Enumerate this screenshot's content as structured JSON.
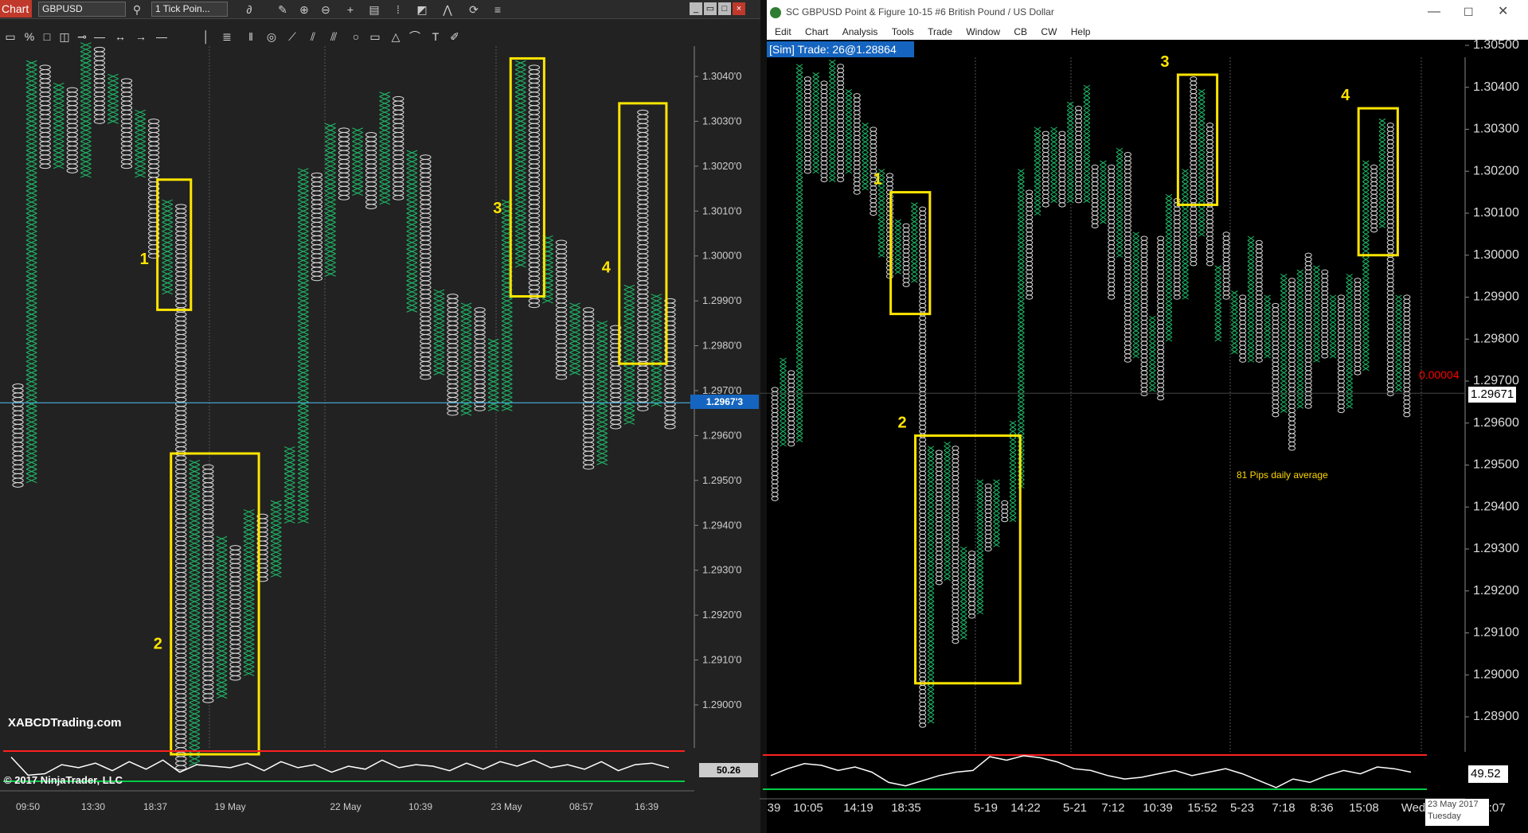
{
  "left_window": {
    "tab": "Chart",
    "instrument": "GBPUSD",
    "period": "1 Tick Poin...",
    "last_price": "1.2967'3",
    "oscillator_value": "50.26",
    "watermark": "XABCDTrading.com",
    "copyright": "© 2017 NinjaTrader, LLC"
  },
  "right_window": {
    "title": "SC GBPUSD  Point & Figure 10-15  #6  British Pound / US Dollar",
    "menu": [
      "Edit",
      "Chart",
      "Analysis",
      "Tools",
      "Trade",
      "Window",
      "CB",
      "CW",
      "Help"
    ],
    "sim_bar": "[Sim]  Trade: 26@1.28864",
    "last_price": "1.29671",
    "offset": "0.00004",
    "note": "81 Pips daily average",
    "oscillator_value": "49.52",
    "date_line1": "23 May 2017",
    "date_line2": "Tuesday"
  },
  "colors": {
    "x_mark": "#1fbf6a",
    "o_mark": "#dddddd",
    "highlight": "#ffe500",
    "osc_high": "#ff2020",
    "osc_low": "#00cc44"
  },
  "chart_data": [
    {
      "type": "point-and-figure",
      "yaxis_ticks": [
        "1.3040'0",
        "1.3030'0",
        "1.3020'0",
        "1.3010'0",
        "1.3000'0",
        "1.2990'0",
        "1.2980'0",
        "1.2970'0",
        "1.2960'0",
        "1.2950'0",
        "1.2940'0",
        "1.2930'0",
        "1.2920'0",
        "1.2910'0",
        "1.2900'0"
      ],
      "yaxis_values": [
        1.304,
        1.303,
        1.302,
        1.301,
        1.3,
        1.299,
        1.298,
        1.297,
        1.296,
        1.295,
        1.294,
        1.293,
        1.292,
        1.291,
        1.29
      ],
      "xaxis_ticks": [
        "09:50",
        "13:30",
        "18:37",
        "19 May",
        "22 May",
        "10:39",
        "23 May",
        "08:57",
        "16:39"
      ],
      "box_size": 0.0001,
      "columns": [
        {
          "type": "O",
          "high": 1.2971,
          "low": 1.2949
        },
        {
          "type": "X",
          "high": 1.3043,
          "low": 1.295
        },
        {
          "type": "O",
          "high": 1.3042,
          "low": 1.302
        },
        {
          "type": "X",
          "high": 1.3038,
          "low": 1.302
        },
        {
          "type": "O",
          "high": 1.3037,
          "low": 1.3019
        },
        {
          "type": "X",
          "high": 1.3047,
          "low": 1.3018
        },
        {
          "type": "O",
          "high": 1.3046,
          "low": 1.303
        },
        {
          "type": "X",
          "high": 1.304,
          "low": 1.303
        },
        {
          "type": "O",
          "high": 1.3039,
          "low": 1.302
        },
        {
          "type": "X",
          "high": 1.3032,
          "low": 1.3018
        },
        {
          "type": "O",
          "high": 1.303,
          "low": 1.3
        },
        {
          "type": "X",
          "high": 1.3012,
          "low": 1.2992
        },
        {
          "type": "O",
          "high": 1.3011,
          "low": 1.2886
        },
        {
          "type": "X",
          "high": 1.2954,
          "low": 1.2887
        },
        {
          "type": "O",
          "high": 1.2953,
          "low": 1.2901
        },
        {
          "type": "X",
          "high": 1.2937,
          "low": 1.2902
        },
        {
          "type": "O",
          "high": 1.2935,
          "low": 1.2906
        },
        {
          "type": "X",
          "high": 1.2943,
          "low": 1.2907
        },
        {
          "type": "O",
          "high": 1.2942,
          "low": 1.2928
        },
        {
          "type": "X",
          "high": 1.2945,
          "low": 1.2929
        },
        {
          "type": "X",
          "high": 1.2957,
          "low": 1.2941
        },
        {
          "type": "X",
          "high": 1.3019,
          "low": 1.2941
        },
        {
          "type": "O",
          "high": 1.3018,
          "low": 1.2995
        },
        {
          "type": "X",
          "high": 1.3029,
          "low": 1.2996
        },
        {
          "type": "O",
          "high": 1.3028,
          "low": 1.3013
        },
        {
          "type": "X",
          "high": 1.3028,
          "low": 1.3014
        },
        {
          "type": "O",
          "high": 1.3027,
          "low": 1.3011
        },
        {
          "type": "X",
          "high": 1.3036,
          "low": 1.3012
        },
        {
          "type": "O",
          "high": 1.3035,
          "low": 1.3013
        },
        {
          "type": "X",
          "high": 1.3023,
          "low": 1.2988
        },
        {
          "type": "O",
          "high": 1.3022,
          "low": 1.2973
        },
        {
          "type": "X",
          "high": 1.2992,
          "low": 1.2974
        },
        {
          "type": "O",
          "high": 1.2991,
          "low": 1.2965
        },
        {
          "type": "X",
          "high": 1.2989,
          "low": 1.2965
        },
        {
          "type": "O",
          "high": 1.2988,
          "low": 1.2966
        },
        {
          "type": "X",
          "high": 1.2981,
          "low": 1.2966
        },
        {
          "type": "X",
          "high": 1.3012,
          "low": 1.2966
        },
        {
          "type": "X",
          "high": 1.3043,
          "low": 1.2998
        },
        {
          "type": "O",
          "high": 1.3042,
          "low": 1.2989
        },
        {
          "type": "X",
          "high": 1.3004,
          "low": 1.299
        },
        {
          "type": "O",
          "high": 1.3003,
          "low": 1.2973
        },
        {
          "type": "X",
          "high": 1.2989,
          "low": 1.2974
        },
        {
          "type": "O",
          "high": 1.2988,
          "low": 1.2953
        },
        {
          "type": "X",
          "high": 1.2985,
          "low": 1.2954
        },
        {
          "type": "O",
          "high": 1.2984,
          "low": 1.2962
        },
        {
          "type": "X",
          "high": 1.2993,
          "low": 1.2963
        },
        {
          "type": "O",
          "high": 1.3032,
          "low": 1.2966
        },
        {
          "type": "X",
          "high": 1.2991,
          "low": 1.2967
        },
        {
          "type": "O",
          "high": 1.299,
          "low": 1.2962
        }
      ],
      "boxes": [
        {
          "label": "1",
          "column_start": 11,
          "column_end": 12,
          "y_top": 1.3017,
          "y_bottom": 1.2988
        },
        {
          "label": "2",
          "column_start": 12,
          "column_end": 17,
          "y_top": 1.2956,
          "y_bottom": 1.2889
        },
        {
          "label": "3",
          "column_start": 37,
          "column_end": 38,
          "y_top": 1.3044,
          "y_bottom": 1.2991
        },
        {
          "label": "4",
          "column_start": 45,
          "column_end": 47,
          "y_top": 1.3034,
          "y_bottom": 1.2976
        }
      ]
    },
    {
      "type": "point-and-figure",
      "yaxis_ticks": [
        "1.30500",
        "1.30400",
        "1.30300",
        "1.30200",
        "1.30100",
        "1.30000",
        "1.29900",
        "1.29800",
        "1.29700",
        "1.29600",
        "1.29500",
        "1.29400",
        "1.29300",
        "1.29200",
        "1.29100",
        "1.29000",
        "1.28900"
      ],
      "yaxis_values": [
        1.305,
        1.304,
        1.303,
        1.302,
        1.301,
        1.3,
        1.299,
        1.298,
        1.297,
        1.296,
        1.295,
        1.294,
        1.293,
        1.292,
        1.291,
        1.29,
        1.289
      ],
      "xaxis_ticks": [
        "39",
        "10:05",
        "14:19",
        "18:35",
        "5-19",
        "14:22",
        "5-21",
        "7:12",
        "10:39",
        "15:52",
        "5-23",
        "7:18",
        "8:36",
        "15:08",
        "Wed",
        "5:07"
      ],
      "box_size": 0.0001,
      "columns": [
        {
          "type": "O",
          "high": 1.2968,
          "low": 1.2942
        },
        {
          "type": "X",
          "high": 1.2975,
          "low": 1.2955
        },
        {
          "type": "O",
          "high": 1.2972,
          "low": 1.2955
        },
        {
          "type": "X",
          "high": 1.3045,
          "low": 1.2956
        },
        {
          "type": "O",
          "high": 1.3042,
          "low": 1.302
        },
        {
          "type": "X",
          "high": 1.3043,
          "low": 1.302
        },
        {
          "type": "O",
          "high": 1.3041,
          "low": 1.3018
        },
        {
          "type": "X",
          "high": 1.3046,
          "low": 1.3018
        },
        {
          "type": "O",
          "high": 1.3045,
          "low": 1.3018
        },
        {
          "type": "X",
          "high": 1.3039,
          "low": 1.302
        },
        {
          "type": "O",
          "high": 1.3038,
          "low": 1.3015
        },
        {
          "type": "X",
          "high": 1.3031,
          "low": 1.3016
        },
        {
          "type": "O",
          "high": 1.303,
          "low": 1.301
        },
        {
          "type": "X",
          "high": 1.302,
          "low": 1.3
        },
        {
          "type": "O",
          "high": 1.3019,
          "low": 1.2995
        },
        {
          "type": "X",
          "high": 1.3008,
          "low": 1.2996
        },
        {
          "type": "O",
          "high": 1.3007,
          "low": 1.2993
        },
        {
          "type": "X",
          "high": 1.3012,
          "low": 1.2994
        },
        {
          "type": "O",
          "high": 1.3011,
          "low": 1.2888
        },
        {
          "type": "X",
          "high": 1.2954,
          "low": 1.2889
        },
        {
          "type": "O",
          "high": 1.2953,
          "low": 1.2922
        },
        {
          "type": "X",
          "high": 1.2955,
          "low": 1.2923
        },
        {
          "type": "O",
          "high": 1.2954,
          "low": 1.2908
        },
        {
          "type": "X",
          "high": 1.293,
          "low": 1.2909
        },
        {
          "type": "O",
          "high": 1.2929,
          "low": 1.2914
        },
        {
          "type": "X",
          "high": 1.2946,
          "low": 1.2915
        },
        {
          "type": "O",
          "high": 1.2945,
          "low": 1.293
        },
        {
          "type": "X",
          "high": 1.2946,
          "low": 1.2931
        },
        {
          "type": "O",
          "high": 1.2941,
          "low": 1.2937
        },
        {
          "type": "X",
          "high": 1.296,
          "low": 1.2937
        },
        {
          "type": "X",
          "high": 1.302,
          "low": 1.2945
        },
        {
          "type": "O",
          "high": 1.3015,
          "low": 1.299
        },
        {
          "type": "X",
          "high": 1.303,
          "low": 1.301
        },
        {
          "type": "O",
          "high": 1.3029,
          "low": 1.3012
        },
        {
          "type": "X",
          "high": 1.303,
          "low": 1.3013
        },
        {
          "type": "O",
          "high": 1.3029,
          "low": 1.3012
        },
        {
          "type": "X",
          "high": 1.3036,
          "low": 1.3013
        },
        {
          "type": "O",
          "high": 1.3035,
          "low": 1.3013
        },
        {
          "type": "X",
          "high": 1.304,
          "low": 1.3013
        },
        {
          "type": "O",
          "high": 1.3021,
          "low": 1.3007
        },
        {
          "type": "X",
          "high": 1.3022,
          "low": 1.3008
        },
        {
          "type": "O",
          "high": 1.3021,
          "low": 1.299
        },
        {
          "type": "X",
          "high": 1.3025,
          "low": 1.3
        },
        {
          "type": "O",
          "high": 1.3024,
          "low": 1.2975
        },
        {
          "type": "X",
          "high": 1.3005,
          "low": 1.2976
        },
        {
          "type": "O",
          "high": 1.3004,
          "low": 1.2967
        },
        {
          "type": "X",
          "high": 1.2985,
          "low": 1.2968
        },
        {
          "type": "O",
          "high": 1.3004,
          "low": 1.2966
        },
        {
          "type": "X",
          "high": 1.3014,
          "low": 1.298
        },
        {
          "type": "O",
          "high": 1.3013,
          "low": 1.299
        },
        {
          "type": "X",
          "high": 1.302,
          "low": 1.299
        },
        {
          "type": "O",
          "high": 1.3042,
          "low": 1.2998
        },
        {
          "type": "X",
          "high": 1.3039,
          "low": 1.3005
        },
        {
          "type": "O",
          "high": 1.3031,
          "low": 1.2998
        },
        {
          "type": "X",
          "high": 1.2997,
          "low": 1.298
        },
        {
          "type": "O",
          "high": 1.3005,
          "low": 1.299
        },
        {
          "type": "X",
          "high": 1.2991,
          "low": 1.2977
        },
        {
          "type": "O",
          "high": 1.299,
          "low": 1.2975
        },
        {
          "type": "X",
          "high": 1.3004,
          "low": 1.2975
        },
        {
          "type": "O",
          "high": 1.3003,
          "low": 1.2975
        },
        {
          "type": "X",
          "high": 1.299,
          "low": 1.2976
        },
        {
          "type": "O",
          "high": 1.2988,
          "low": 1.2962
        },
        {
          "type": "X",
          "high": 1.2995,
          "low": 1.2963
        },
        {
          "type": "O",
          "high": 1.2994,
          "low": 1.2954
        },
        {
          "type": "X",
          "high": 1.2996,
          "low": 1.2964
        },
        {
          "type": "O",
          "high": 1.3,
          "low": 1.2964
        },
        {
          "type": "X",
          "high": 1.2997,
          "low": 1.2975
        },
        {
          "type": "O",
          "high": 1.2996,
          "low": 1.2976
        },
        {
          "type": "X",
          "high": 1.299,
          "low": 1.2976
        },
        {
          "type": "O",
          "high": 1.299,
          "low": 1.2963
        },
        {
          "type": "X",
          "high": 1.2995,
          "low": 1.2964
        },
        {
          "type": "O",
          "high": 1.2994,
          "low": 1.2972
        },
        {
          "type": "X",
          "high": 1.3022,
          "low": 1.2973
        },
        {
          "type": "O",
          "high": 1.3021,
          "low": 1.3006
        },
        {
          "type": "X",
          "high": 1.3032,
          "low": 1.3007
        },
        {
          "type": "O",
          "high": 1.3031,
          "low": 1.2967
        },
        {
          "type": "X",
          "high": 1.299,
          "low": 1.2968
        },
        {
          "type": "O",
          "high": 1.299,
          "low": 1.2962
        }
      ],
      "boxes": [
        {
          "label": "1",
          "column_start": 15,
          "column_end": 18,
          "y_top": 1.3015,
          "y_bottom": 1.2986
        },
        {
          "label": "2",
          "column_start": 18,
          "column_end": 29,
          "y_top": 1.2957,
          "y_bottom": 1.2898
        },
        {
          "label": "3",
          "column_start": 50,
          "column_end": 53,
          "y_top": 1.3043,
          "y_bottom": 1.3012
        },
        {
          "label": "4",
          "column_start": 72,
          "column_end": 75,
          "y_top": 1.3035,
          "y_bottom": 1.3
        }
      ]
    }
  ]
}
